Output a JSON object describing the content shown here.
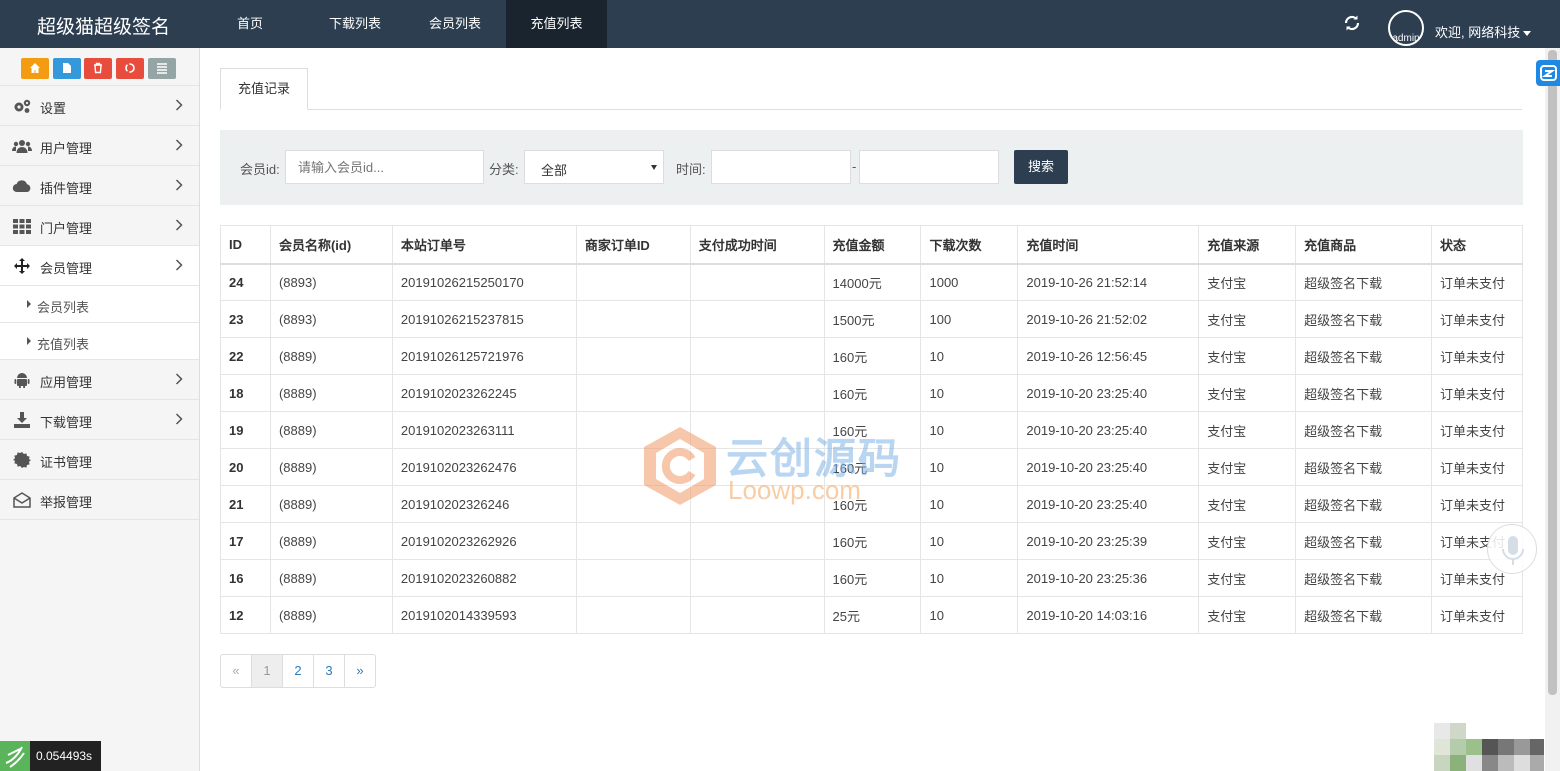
{
  "app_title": "超级猫超级签名",
  "nav": [
    {
      "label": "首页",
      "active": false
    },
    {
      "label": "下载列表",
      "active": false
    },
    {
      "label": "会员列表",
      "active": false
    },
    {
      "label": "充值列表",
      "active": true
    }
  ],
  "user": {
    "avatar_alt": "admin",
    "welcome": "欢迎, 网络科技"
  },
  "sidebar": {
    "shortcuts": [
      {
        "icon": "home-icon",
        "color": "#f39c12"
      },
      {
        "icon": "file-icon",
        "color": "#3498db"
      },
      {
        "icon": "trash-icon",
        "color": "#e74c3c"
      },
      {
        "icon": "recycle-icon",
        "color": "#e74c3c"
      },
      {
        "icon": "list-icon",
        "color": "#95a5a6"
      }
    ],
    "items": [
      {
        "label": "设置",
        "icon": "gears-icon"
      },
      {
        "label": "用户管理",
        "icon": "users-icon"
      },
      {
        "label": "插件管理",
        "icon": "cloud-icon"
      },
      {
        "label": "门户管理",
        "icon": "grid-icon"
      },
      {
        "label": "会员管理",
        "icon": "move-icon",
        "open": true,
        "children": [
          "会员列表",
          "充值列表"
        ]
      },
      {
        "label": "应用管理",
        "icon": "android-icon"
      },
      {
        "label": "下载管理",
        "icon": "download-icon"
      },
      {
        "label": "证书管理",
        "icon": "certificate-icon"
      },
      {
        "label": "举报管理",
        "icon": "envelope-icon"
      }
    ]
  },
  "timer": "0.054493s",
  "tab": "充值记录",
  "filter": {
    "member_label": "会员id:",
    "member_placeholder": "请输入会员id...",
    "category_label": "分类:",
    "category_value": "全部",
    "time_label": "时间:",
    "dash": "-",
    "search_button": "搜索"
  },
  "table": {
    "headers": [
      "ID",
      "会员名称(id)",
      "本站订单号",
      "商家订单ID",
      "支付成功时间",
      "充值金额",
      "下载次数",
      "充值时间",
      "充值来源",
      "充值商品",
      "状态"
    ],
    "rows": [
      [
        "24",
        "(8893)",
        "20191026215250170",
        "",
        "",
        "14000元",
        "1000",
        "2019-10-26 21:52:14",
        "支付宝",
        "超级签名下载",
        "订单未支付"
      ],
      [
        "23",
        "(8893)",
        "20191026215237815",
        "",
        "",
        "1500元",
        "100",
        "2019-10-26 21:52:02",
        "支付宝",
        "超级签名下载",
        "订单未支付"
      ],
      [
        "22",
        "(8889)",
        "20191026125721976",
        "",
        "",
        "160元",
        "10",
        "2019-10-26 12:56:45",
        "支付宝",
        "超级签名下载",
        "订单未支付"
      ],
      [
        "18",
        "(8889)",
        "2019102023262245",
        "",
        "",
        "160元",
        "10",
        "2019-10-20 23:25:40",
        "支付宝",
        "超级签名下载",
        "订单未支付"
      ],
      [
        "19",
        "(8889)",
        "2019102023263111",
        "",
        "",
        "160元",
        "10",
        "2019-10-20 23:25:40",
        "支付宝",
        "超级签名下载",
        "订单未支付"
      ],
      [
        "20",
        "(8889)",
        "2019102023262476",
        "",
        "",
        "160元",
        "10",
        "2019-10-20 23:25:40",
        "支付宝",
        "超级签名下载",
        "订单未支付"
      ],
      [
        "21",
        "(8889)",
        "201910202326246",
        "",
        "",
        "160元",
        "10",
        "2019-10-20 23:25:40",
        "支付宝",
        "超级签名下载",
        "订单未支付"
      ],
      [
        "17",
        "(8889)",
        "2019102023262926",
        "",
        "",
        "160元",
        "10",
        "2019-10-20 23:25:39",
        "支付宝",
        "超级签名下载",
        "订单未支付"
      ],
      [
        "16",
        "(8889)",
        "2019102023260882",
        "",
        "",
        "160元",
        "10",
        "2019-10-20 23:25:36",
        "支付宝",
        "超级签名下载",
        "订单未支付"
      ],
      [
        "12",
        "(8889)",
        "2019102014339593",
        "",
        "",
        "25元",
        "10",
        "2019-10-20 14:03:16",
        "支付宝",
        "超级签名下载",
        "订单未支付"
      ]
    ]
  },
  "pagination": [
    "«",
    "1",
    "2",
    "3",
    "»"
  ],
  "watermark": {
    "cn": "云创源码",
    "en": "Loowp.com"
  },
  "colors": {
    "navbar": "#2c3e50",
    "navbar_active": "#1a242f",
    "filter_bg": "#ecf0f1",
    "link": "#2c7ab8"
  }
}
